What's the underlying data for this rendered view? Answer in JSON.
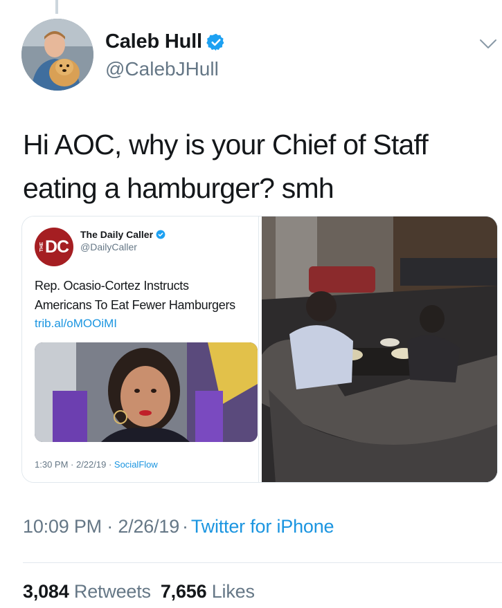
{
  "tweet": {
    "author": {
      "display_name": "Caleb Hull",
      "handle": "@CalebJHull",
      "verified": true,
      "avatar_icon": "profile-photo"
    },
    "text_line1": "Hi AOC, why is your Chief of Staff",
    "text_line2": "eating a hamburger? smh",
    "timestamp": "10:09 PM · 2/26/19",
    "separator": "·",
    "client": "Twitter for iPhone",
    "stats": {
      "retweets_count": "3,084",
      "retweets_label": "Retweets",
      "likes_count": "7,656",
      "likes_label": "Likes"
    }
  },
  "quoted": {
    "logo_text": "DC",
    "logo_small": "THE",
    "name": "The Daily Caller",
    "handle": "@DailyCaller",
    "verified": true,
    "text_line1": "Rep. Ocasio-Cortez Instructs",
    "text_line2": "Americans To Eat Fewer Hamburgers",
    "link": "trib.al/oMOOiMI",
    "meta_time": "1:30 PM · 2/22/19 · ",
    "meta_source": "SocialFlow"
  },
  "colors": {
    "text_primary": "#14171a",
    "text_secondary": "#657786",
    "link": "#1b95e0",
    "verified_badge": "#1da1f2",
    "dc_red": "#a51e22"
  }
}
